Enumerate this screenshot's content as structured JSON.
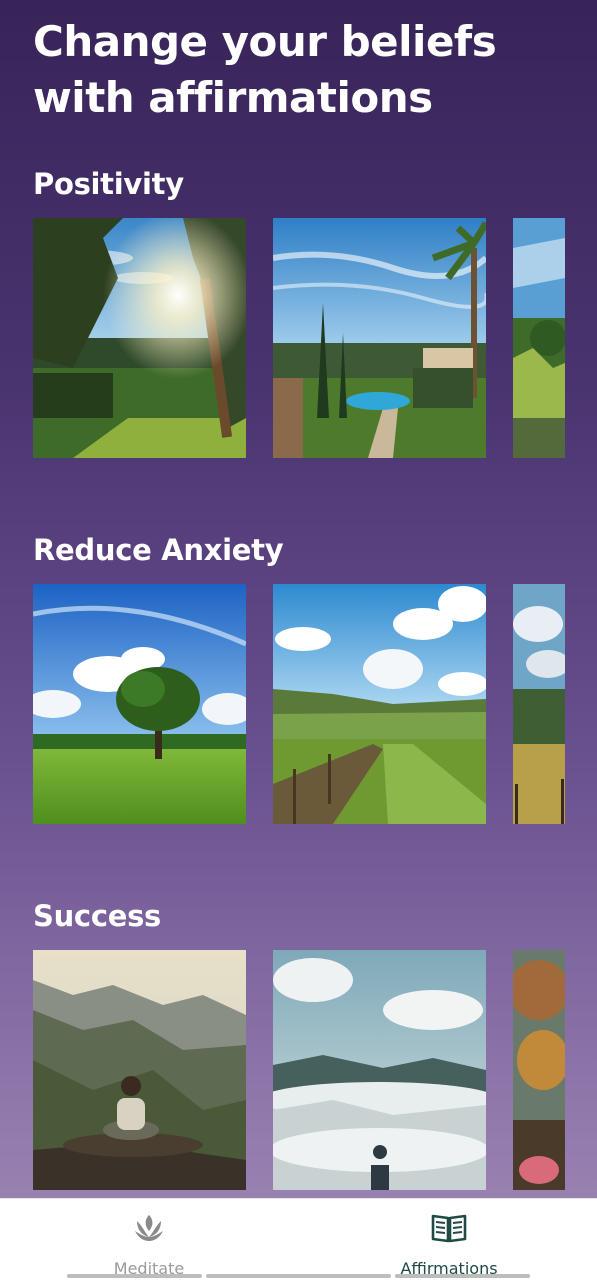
{
  "page_title": "Change your beliefs with affirmations",
  "sections": [
    {
      "title": "Positivity",
      "cards": [
        "sunny-garden-image",
        "villa-pool-garden-image",
        "tropical-garden-image"
      ]
    },
    {
      "title": "Reduce Anxiety",
      "cards": [
        "lone-tree-meadow-image",
        "countryside-path-image",
        "rolling-hills-image"
      ]
    },
    {
      "title": "Success",
      "cards": [
        "mountain-meditation-image",
        "misty-valley-silhouette-image",
        "autumn-forest-image"
      ]
    }
  ],
  "bottom_nav": {
    "items": [
      {
        "label": "Meditate",
        "icon": "lotus-icon",
        "active": false
      },
      {
        "label": "Affirmations",
        "icon": "open-book-icon",
        "active": true
      }
    ],
    "active_color": "#1f4a45",
    "inactive_color": "#9a9a9a"
  }
}
